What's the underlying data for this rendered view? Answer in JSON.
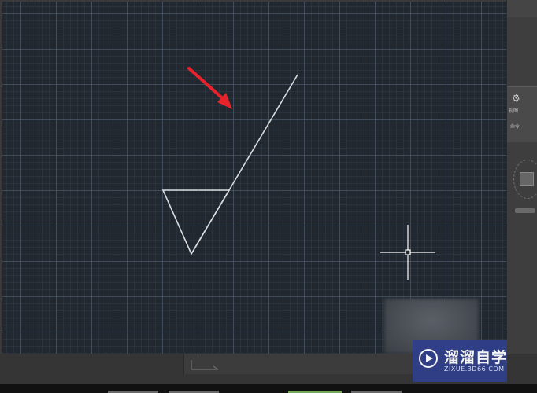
{
  "app": {
    "type": "cad-drawing-canvas"
  },
  "canvas": {
    "background": "#212830",
    "line_color": "#d9dce0",
    "arrow_color": "#e8222a",
    "cursor_color": "#ffffff"
  },
  "icons": {
    "cursor": "crosshair-cursor-icon",
    "annotation": "red-arrow-icon",
    "nav": "steering-wheel-icon",
    "ucs": "ucs-axis-icon",
    "watermark_logo": "play-circle-icon"
  },
  "side_panel": {
    "label_top": "视图",
    "label_bottom": "命令"
  },
  "watermark": {
    "title": "溜溜自学",
    "subtitle": "ZIXUE.3D66.COM",
    "color": "#2f3f8a"
  }
}
